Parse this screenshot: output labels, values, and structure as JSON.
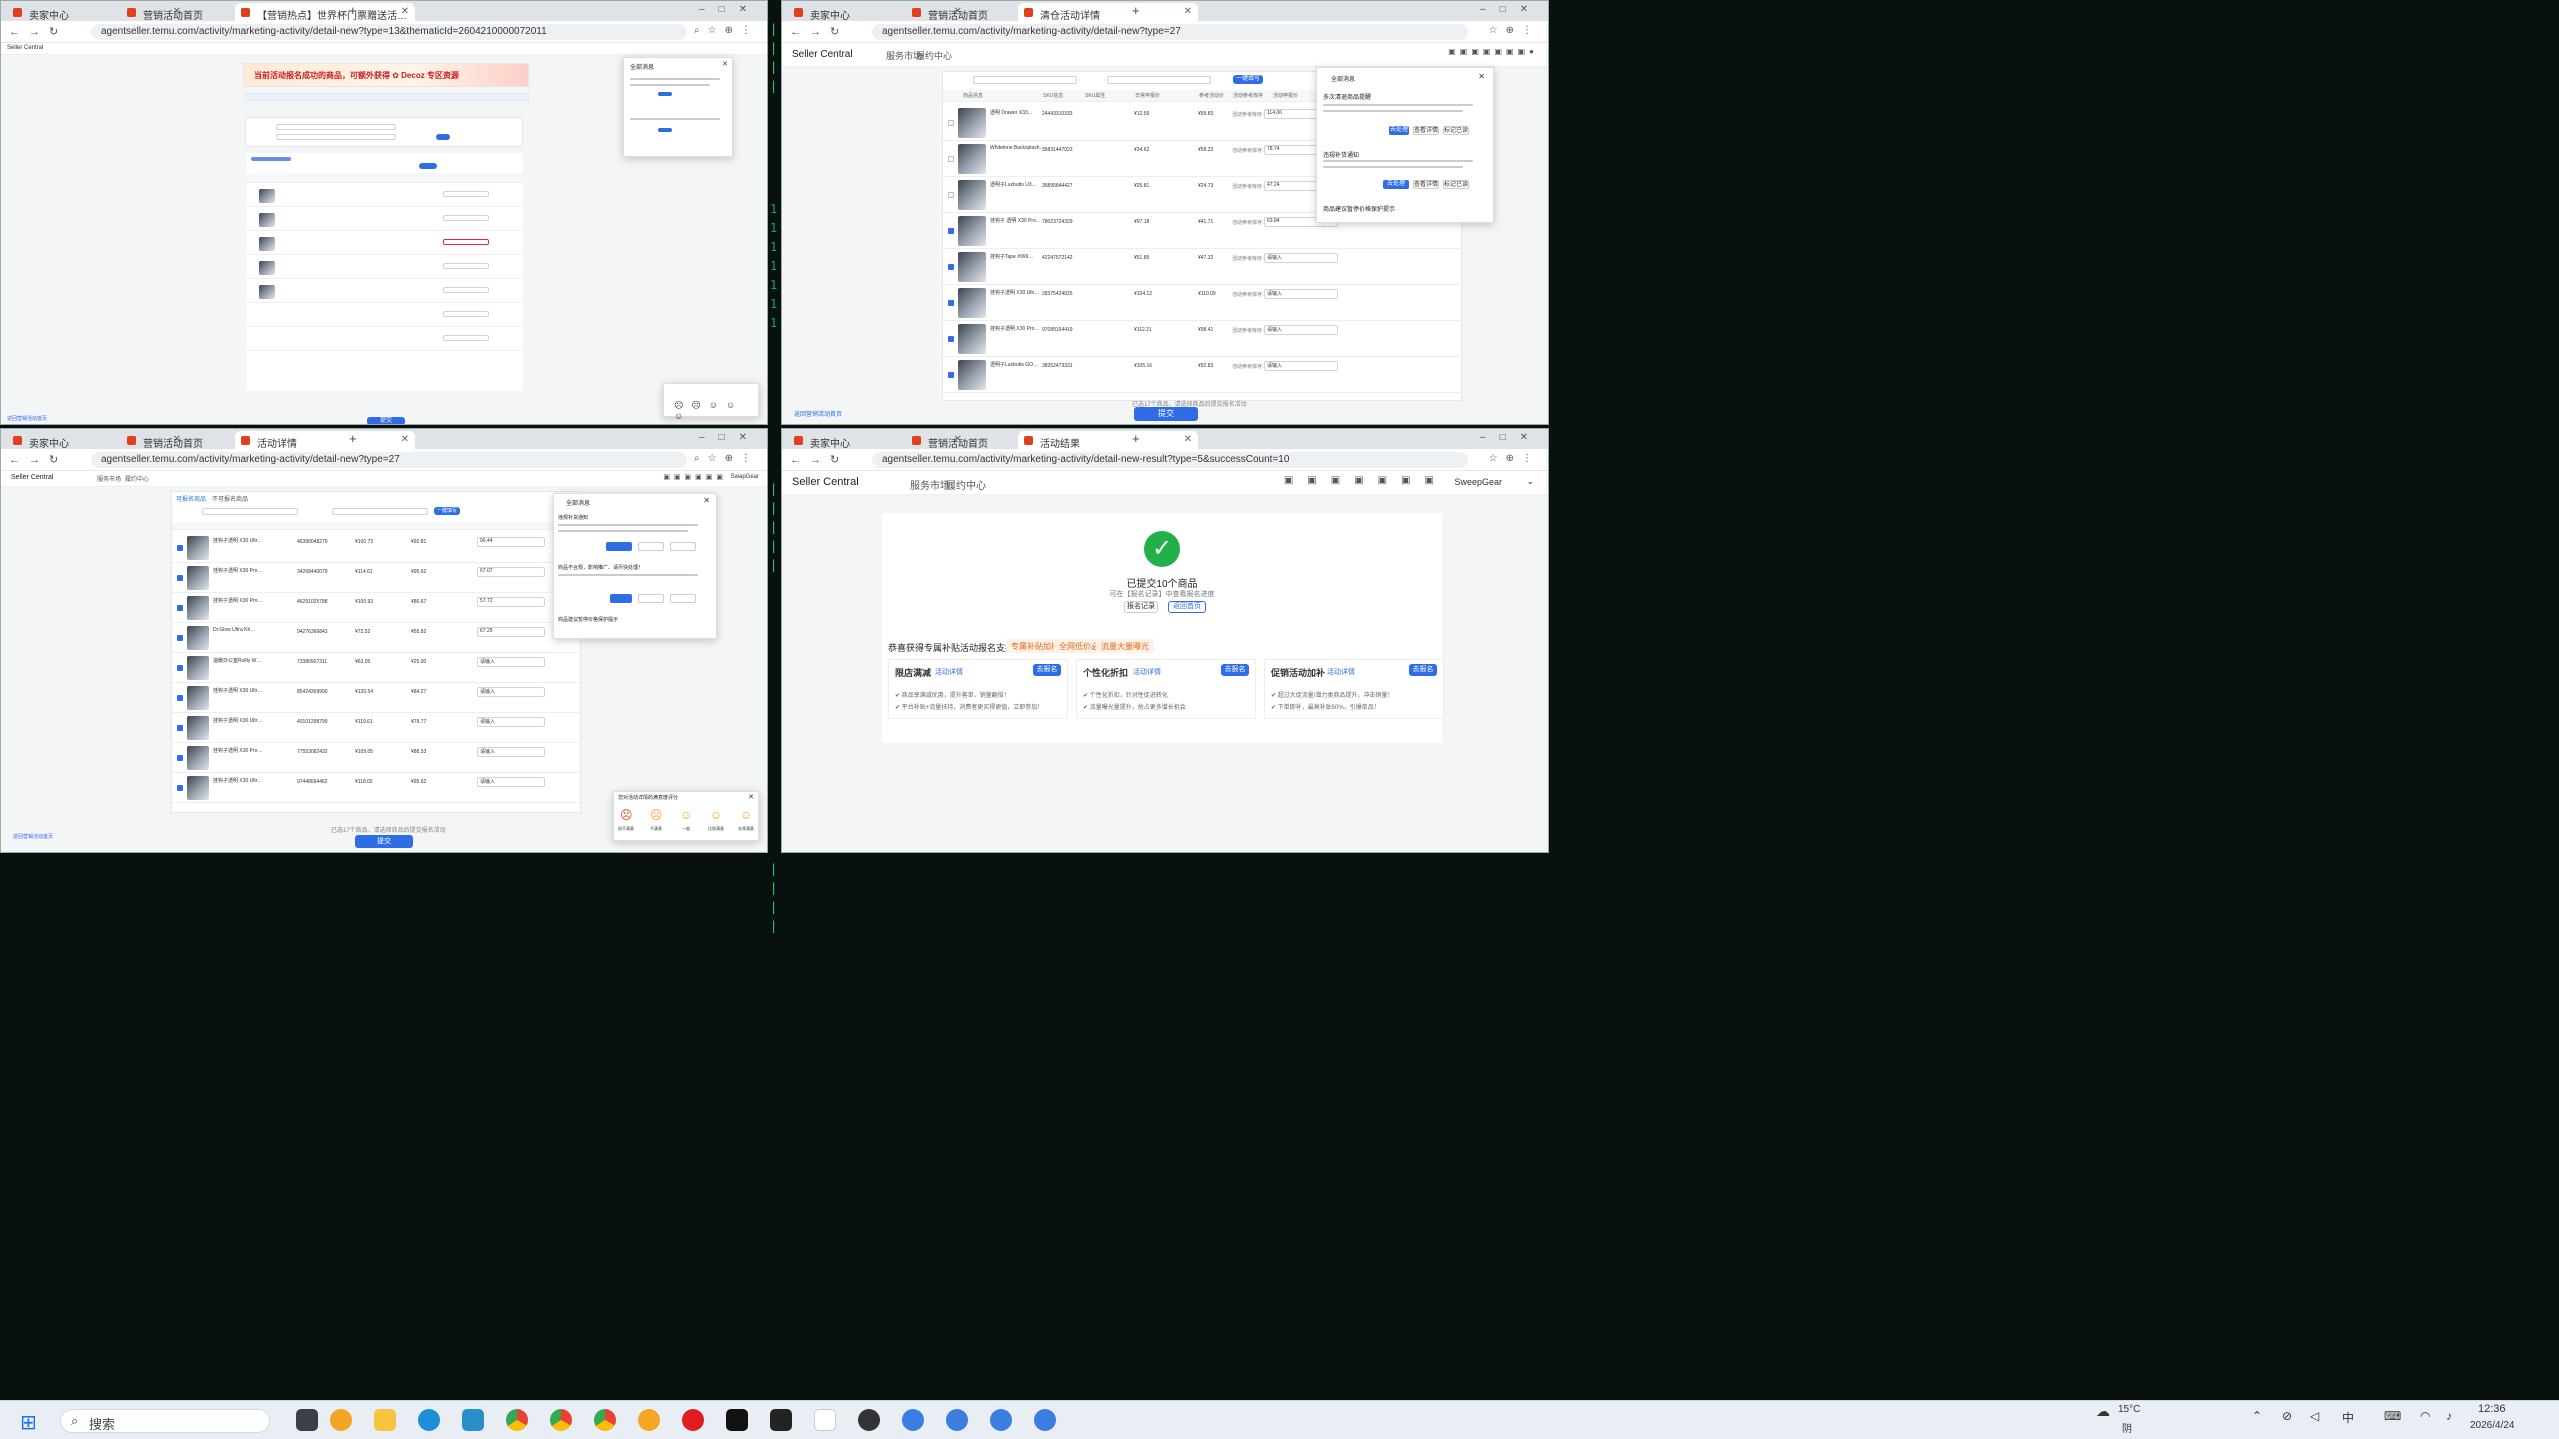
{
  "desktop": {
    "code_lines": [
      "#",
      "# ",
      "#  ",
      "#",
      "# ",
      "##"
    ]
  },
  "win1": {
    "tabs": [
      {
        "label": "卖家中心"
      },
      {
        "label": "营销活动首页"
      },
      {
        "label": "【营销热点】世界杯门票赠送活…"
      }
    ],
    "url": "agentseller.temu.com/activity/marketing-activity/detail-new?type=13&thematicId=2604210000072011",
    "banner": "当前活动报名成功的商品，可额外获得 ✿ Decoz 专区资源",
    "header_brand": "Seller Central",
    "submit": "提交",
    "popup_title": "全部消息",
    "footer_link": "返回营销活动首页"
  },
  "win2": {
    "tabs": [
      {
        "label": "卖家中心"
      },
      {
        "label": "营销活动首页"
      },
      {
        "label": "清仓活动详情"
      }
    ],
    "url": "agentseller.temu.com/activity/marketing-activity/detail-new?type=27",
    "header_brand": "Seller Central",
    "menu": [
      "服务市场",
      "履约中心"
    ],
    "filter_btn": "一键填写",
    "columns": [
      "商品信息",
      "SKU信息",
      "SKU属性",
      "日常申报价",
      "参考活动价",
      "活动参考库存",
      "活动申报价"
    ],
    "rows": [
      {
        "name": "透明 Drawer X33…",
        "sku": "24443310333",
        "price": "¥12.59",
        "ref": "¥59.83",
        "stock": "活动参考库存 30",
        "input": "114.06"
      },
      {
        "name": "Whitetone Backsplash…",
        "sku": "35831447023",
        "price": "¥34.62",
        "ref": "¥59.23",
        "stock": "活动参考库存 30",
        "input": "78.74"
      },
      {
        "name": "透明子Luxbutts U3…",
        "sku": "35895844427",
        "price": "¥25.81",
        "ref": "¥24.73",
        "stock": "活动参考库存 30",
        "input": "47.24"
      },
      {
        "name": "挂钩子 透明 X30 Pro…",
        "sku": "78023724329",
        "price": "¥97.18",
        "ref": "¥41.71",
        "stock": "活动参考库存 30",
        "input": "63.84"
      },
      {
        "name": "挂钩子Tape #999…",
        "sku": "42247572142",
        "price": "¥51.89",
        "ref": "¥47.32",
        "stock": "活动参考库存 30",
        "input": "请输入"
      },
      {
        "name": "挂钩子透明 X30 Ultr…",
        "sku": "28375424025",
        "price": "¥104.12",
        "ref": "¥110.09",
        "stock": "活动参考库存 30",
        "input": "请输入"
      },
      {
        "name": "挂钩子透明 X30 Pro…",
        "sku": "97089154419",
        "price": "¥112.21",
        "ref": "¥98.41",
        "stock": "活动参考库存 30",
        "input": "请输入"
      },
      {
        "name": "透明子Luxbutts GO…",
        "sku": "38352473331",
        "price": "¥105.16",
        "ref": "¥92.83",
        "stock": "活动参考库存 30",
        "input": "请输入"
      }
    ],
    "popup_title": "全部消息",
    "popup_items": [
      "多次清退商品提醒",
      "违规补货通知",
      "商品建议暂停价格保护提示"
    ],
    "popup_buttons": [
      "去处理",
      "查看详情",
      "标记已读"
    ],
    "footer_hint": "已选17个商品，请选择商品后提交报名活动",
    "submit": "提交",
    "footer_link": "返回营销活动首页"
  },
  "win3": {
    "tabs": [
      {
        "label": "卖家中心"
      },
      {
        "label": "营销活动首页"
      },
      {
        "label": "活动详情"
      }
    ],
    "url": "agentseller.temu.com/activity/marketing-activity/detail-new?type=27",
    "header_brand": "Seller Central",
    "menu": [
      "服务市场",
      "履约中心"
    ],
    "user": "SwapGear",
    "tabs_inner": [
      "可报名商品",
      "不可报名商品"
    ],
    "filter_btn": "一键填写",
    "rows": [
      {
        "name": "挂钩子透明 X30 Ultr…",
        "sku": "46390048279",
        "price": "¥100.73",
        "ref": "¥92.81",
        "input": "90.44"
      },
      {
        "name": "挂钩子透明 X30 Pro…",
        "sku": "34268440079",
        "price": "¥114.61",
        "ref": "¥95.62",
        "input": "67.07"
      },
      {
        "name": "挂钩子透明 X30 Pro…",
        "sku": "46291025788",
        "price": "¥100.93",
        "ref": "¥86.67",
        "input": "57.72"
      },
      {
        "name": "Dr.Glow Ultra Kit…",
        "sku": "94276366843",
        "price": "¥72.52",
        "ref": "¥55.82",
        "input": "67.25"
      },
      {
        "name": "温暖办公室Rollly W…",
        "sku": "73380907311",
        "price": "¥63.05",
        "ref": "¥25.00",
        "input": "请输入"
      },
      {
        "name": "挂钩子透明 X30 Ultr…",
        "sku": "85424369990",
        "price": "¥120.54",
        "ref": "¥84.27",
        "input": "请输入"
      },
      {
        "name": "挂钩子透明 X30 Ultr…",
        "sku": "40101298799",
        "price": "¥119.61",
        "ref": "¥79.77",
        "input": "请输入"
      },
      {
        "name": "挂钩子透明 X30 Pro…",
        "sku": "77553082432",
        "price": "¥109.05",
        "ref": "¥88.53",
        "input": "请输入"
      },
      {
        "name": "挂钩子透明 X30 Ultr…",
        "sku": "97448694462",
        "price": "¥118.02",
        "ref": "¥95.62",
        "input": "请输入"
      }
    ],
    "popup_title": "全部消息",
    "popup_items": [
      "违规补货通知",
      "商品不合规，影响推广、请尽快处理！",
      "商品建议暂停价格保护提示"
    ],
    "rating_title": "您对活动详情的满意度评分",
    "ratings": [
      "很不满意",
      "不满意",
      "一般",
      "比较满意",
      "非常满意"
    ],
    "footer_hint": "已选17个商品，请选择商品后提交报名活动",
    "submit": "提交",
    "footer_link": "返回营销活动首页"
  },
  "win4": {
    "tabs": [
      {
        "label": "卖家中心"
      },
      {
        "label": "营销活动首页"
      },
      {
        "label": "活动结果"
      }
    ],
    "url": "agentseller.temu.com/activity/marketing-activity/detail-new-result?type=5&successCount=10",
    "header_brand": "Seller Central",
    "menu": [
      "服务市场",
      "履约中心"
    ],
    "user": "SweepGear",
    "success_title": "已提交10个商品",
    "success_sub": "可在【报名记录】中查看报名进度",
    "btn_record": "报名记录",
    "btn_back": "返回首页",
    "promo_title": "恭喜获得专属补贴活动报名支持",
    "promo_tags": [
      "专属补贴加持",
      "全网低价必看",
      "流量大量曝光"
    ],
    "cards": [
      {
        "title": "限店满减",
        "link": "活动详情",
        "btn": "去报名",
        "l1": "✔ 商品享满减优惠，提升客单，销量翻倍！",
        "l2": "✔ 平台补贴+流量扶持，消费者更买得更值，立即参加！"
      },
      {
        "title": "个性化折扣",
        "link": "活动详情",
        "btn": "去报名",
        "l1": "✔ 个性化折扣，针对性促进转化",
        "l2": "✔ 流量曝光量提升，抢占更多增长机会"
      },
      {
        "title": "促销活动加补",
        "link": "活动详情",
        "btn": "去报名",
        "l1": "✔ 超过大促流量/潜力类商品提升，冲击销量！",
        "l2": "✔ 下单即补，最高补贴50%，引爆单品！"
      }
    ]
  },
  "taskbar": {
    "search": "搜索",
    "weather": "15°C",
    "weather_sub": "阴",
    "time": "12:36",
    "date": "2026/4/24",
    "ime": "中"
  }
}
